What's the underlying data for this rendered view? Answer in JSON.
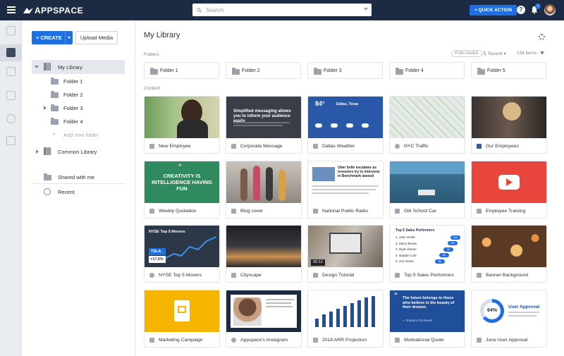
{
  "app": {
    "brand": "APPSPACE"
  },
  "search": {
    "placeholder": "Search"
  },
  "topbar": {
    "quick_action": "+ QUICK ACTION",
    "help": "?",
    "notifications": "1"
  },
  "sidebar": {
    "create_label": "+ CREATE",
    "upload_label": "Upload Media",
    "my_library": "My Library",
    "folders": [
      "Folder 1",
      "Folder 2",
      "Folder 3",
      "Folder 4"
    ],
    "add_folder": "Add new folder",
    "common_library": "Common Library",
    "shared": "Shared with me",
    "recent": "Recent"
  },
  "main": {
    "title": "My Library",
    "folders_heading": "Folders",
    "content_heading": "Content",
    "filter_published": "PUBLISHED",
    "sort_label": "Recent",
    "item_count": "134 items",
    "folders": [
      "Folder 1",
      "Folder 2",
      "Folder 3",
      "Folder 4",
      "Folder 5"
    ],
    "items": [
      "New Employee",
      "Corporate Message",
      "Dallas Weather",
      "NYC Traffic",
      "Our Employees",
      "Weekly Quotation",
      "Blog cover",
      "National Public Radio",
      "Old School Car",
      "Employee Training",
      "NYSE Top 5 Movers",
      "Cityscape",
      "Design Tutorial",
      "Top 5 Sales Performers",
      "Banner Background",
      "Marketing Campaign",
      "Appspace's Instagram",
      "2018 ARR Projection",
      "Motivational Quote",
      "June User Approval"
    ]
  },
  "thumbs": {
    "corporate": "Simplified messaging allows you to inform your audience easily",
    "weather_temp": "84°",
    "weather_city": "Dallas, Texas",
    "quote_mark": "“",
    "weekly_quote": "CREATIVITY IS INTELLIGENCE HAVING FUN",
    "npr_headline": "Uber belle escalates as investors try to intervene in Benchmark lawsuit",
    "nyse_title": "NYSE Top 5 Movers",
    "nyse_ticker": "TSLA",
    "nyse_change": "+17.6%",
    "video_time": "00:12",
    "sales_title": "Top 5 Sales Performers",
    "sales": [
      {
        "name": "1. John Smith",
        "val": "12k"
      },
      {
        "name": "2. Merry Brown",
        "val": "11k"
      },
      {
        "name": "3. Ryan Keene",
        "val": "9k"
      },
      {
        "name": "4. Natalie Cole",
        "val": "8k"
      },
      {
        "name": "5. Jon Green",
        "val": "6k"
      }
    ],
    "motivational": "The future belongs to those who believe in the beauty of their dreams.",
    "motivational_author": "— Eleanor Roosevelt",
    "approval_pct": "64%",
    "approval_title": "User Approval"
  },
  "colors": {
    "topbar": "#1c2a44",
    "accent": "#1f6fe0",
    "green": "#2f8a5f",
    "red": "#e8463c",
    "yellow": "#f5b400"
  }
}
